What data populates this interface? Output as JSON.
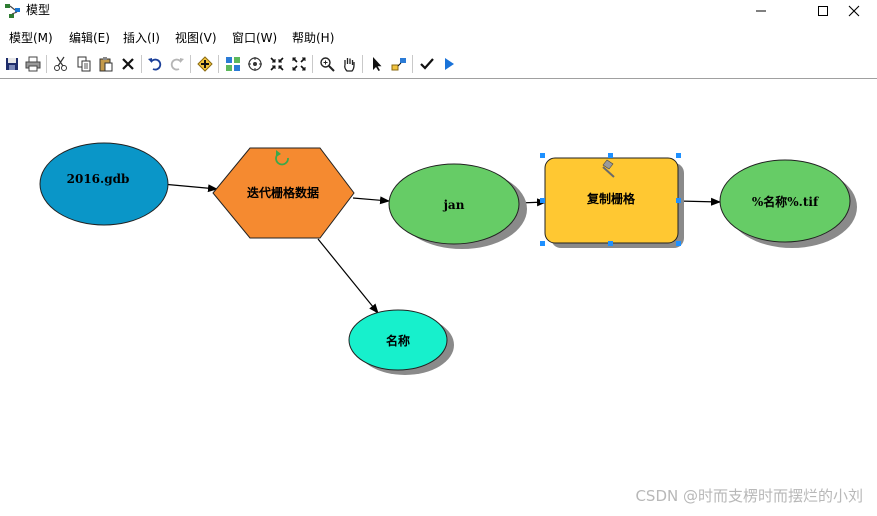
{
  "window": {
    "title": "模型"
  },
  "menu": {
    "items": [
      {
        "label": "模型(M)"
      },
      {
        "label": "编辑(E)"
      },
      {
        "label": "插入(I)"
      },
      {
        "label": "视图(V)"
      },
      {
        "label": "窗口(W)"
      },
      {
        "label": "帮助(H)"
      }
    ]
  },
  "model": {
    "nodes": {
      "input_gdb": {
        "label": "2016.gdb",
        "color": "#0a96c8"
      },
      "iterator": {
        "label": "迭代栅格数据",
        "color": "#f58a30"
      },
      "jan": {
        "label": "jan",
        "color": "#66cc66"
      },
      "copy_raster": {
        "label": "复制栅格",
        "color": "#ffc832"
      },
      "output_tif": {
        "label": "%名称%.tif",
        "color": "#66cc66"
      },
      "name_var": {
        "label": "名称",
        "color": "#17f0cc"
      }
    }
  },
  "watermark": "CSDN @时而支楞时而摆烂的小刘"
}
